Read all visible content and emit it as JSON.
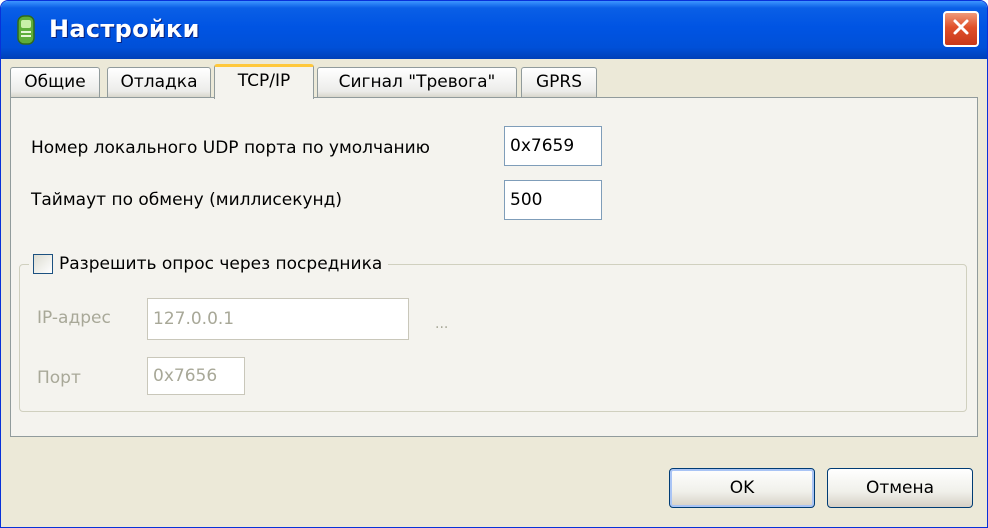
{
  "window": {
    "title": "Настройки",
    "icons": {
      "app": "app-icon",
      "close": "close-icon"
    }
  },
  "tabs": [
    {
      "label": "Общие",
      "active": false
    },
    {
      "label": "Отладка",
      "active": false
    },
    {
      "label": "TCP/IP",
      "active": true
    },
    {
      "label": "Сигнал \"Тревога\"",
      "active": false
    },
    {
      "label": "GPRS",
      "active": false
    }
  ],
  "tcp": {
    "udp_port_label": "Номер локального UDP порта по умолчанию",
    "udp_port_value": "0x7659",
    "timeout_label": "Таймаут по обмену (миллисекунд)",
    "timeout_value": "500"
  },
  "proxy": {
    "checkbox_label": "Разрешить опрос через посредника",
    "checked": false,
    "ip_label": "IP-адрес",
    "ip_value": "127.0.0.1",
    "browse_label": "...",
    "port_label": "Порт",
    "port_value": "0x7656"
  },
  "buttons": {
    "ok": "OK",
    "cancel": "Отмена"
  },
  "colors": {
    "titlebar": "#0054e3",
    "dialog_bg": "#ece9d8",
    "active_tab_accent": "#ffc83c",
    "close_button": "#e0502a"
  }
}
